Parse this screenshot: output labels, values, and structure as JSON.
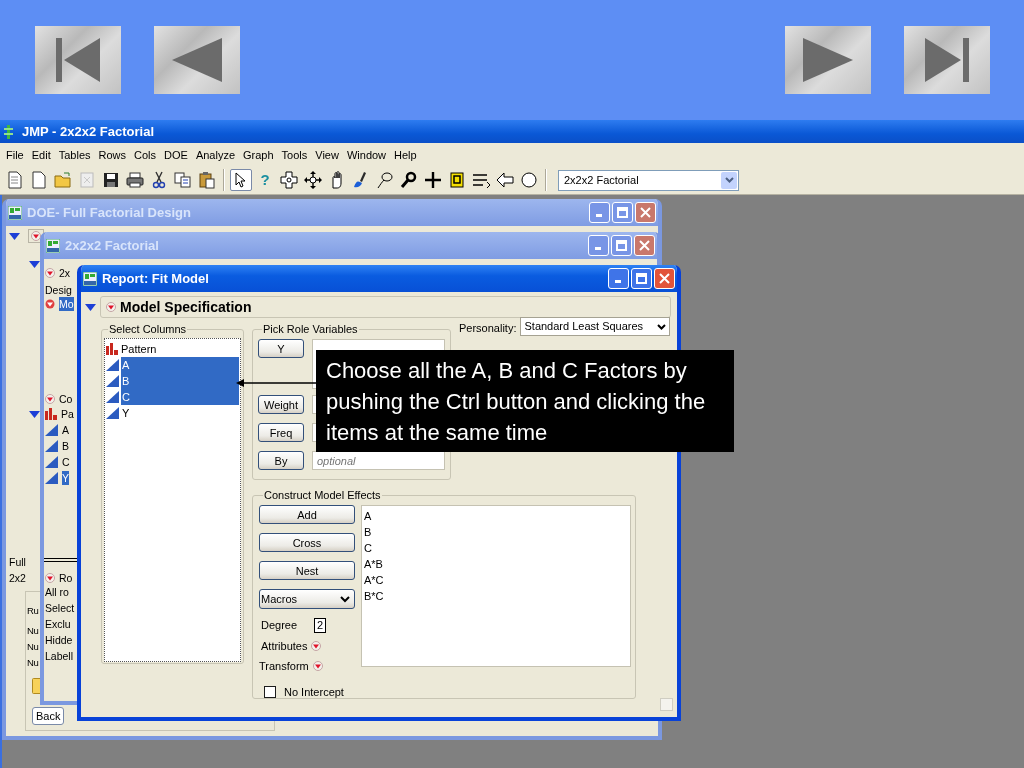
{
  "slide_nav": [
    {
      "kind": "first"
    },
    {
      "kind": "previous"
    },
    {
      "kind": "next"
    },
    {
      "kind": "last"
    }
  ],
  "app": {
    "title": "JMP - 2x2x2 Factorial",
    "menu": [
      "File",
      "Edit",
      "Tables",
      "Rows",
      "Cols",
      "DOE",
      "Analyze",
      "Graph",
      "Tools",
      "View",
      "Window",
      "Help"
    ],
    "tools": [
      {
        "kind": "pointer",
        "selected": true
      },
      {
        "kind": "help",
        "glyph": "?",
        "selected": false
      },
      {
        "kind": "crosshair",
        "selected": false
      },
      {
        "kind": "move",
        "selected": false
      },
      {
        "kind": "hand",
        "selected": false
      },
      {
        "kind": "brush",
        "selected": false
      },
      {
        "kind": "lasso",
        "selected": false
      },
      {
        "kind": "zoom",
        "selected": false
      },
      {
        "kind": "plus",
        "selected": false
      },
      {
        "kind": "annotate",
        "selected": false
      },
      {
        "kind": "lines",
        "selected": false
      },
      {
        "kind": "polygon",
        "selected": false
      },
      {
        "kind": "circle",
        "selected": false
      }
    ],
    "table_select": "2x2x2 Factorial"
  },
  "doe_window": {
    "title": "DOE- Full Factorial Design",
    "lines": [
      "Full",
      "2x2"
    ],
    "panel_lines": [
      "Ru",
      "Nu",
      "Nu",
      "Nu"
    ],
    "back_button": "Back"
  },
  "factorial_window": {
    "title": "2x2x2 Factorial",
    "table_outline": "2x",
    "design_label": "Desig",
    "model_item": "Mo",
    "columns_outline": "Co",
    "columns": [
      {
        "label": "Pa",
        "kind": "nominal",
        "selected": false
      },
      {
        "label": "A",
        "kind": "continuous",
        "selected": false
      },
      {
        "label": "B",
        "kind": "continuous",
        "selected": false
      },
      {
        "label": "C",
        "kind": "continuous",
        "selected": false
      },
      {
        "label": "Y",
        "kind": "continuous",
        "selected": true
      }
    ],
    "rows_outline": "Ro",
    "rows": [
      "All ro",
      "Select",
      "Exclu",
      "Hidde",
      "Labell"
    ]
  },
  "report_window": {
    "title": "Report: Fit Model",
    "outline": "Model Specification",
    "select_columns": {
      "title": "Select Columns",
      "items": [
        {
          "label": "Pattern",
          "kind": "nominal",
          "selected": false
        },
        {
          "label": "A",
          "kind": "continuous",
          "selected": true
        },
        {
          "label": "B",
          "kind": "continuous",
          "selected": true
        },
        {
          "label": "C",
          "kind": "continuous",
          "selected": true
        },
        {
          "label": "Y",
          "kind": "continuous",
          "selected": false
        }
      ]
    },
    "pick_roles": {
      "title": "Pick Role Variables",
      "roles": [
        {
          "label": "Y",
          "kind": "tall"
        },
        {
          "label": "Weight",
          "kind": "single"
        },
        {
          "label": "Freq",
          "kind": "single"
        },
        {
          "label": "By",
          "kind": "single",
          "placeholder": "optional"
        }
      ]
    },
    "personality": {
      "label": "Personality:",
      "value": "Standard Least Squares"
    },
    "construct": {
      "title": "Construct Model Effects",
      "buttons": [
        "Add",
        "Cross",
        "Nest"
      ],
      "macros": "Macros",
      "degree_label": "Degree",
      "degree": "2",
      "attributes": "Attributes",
      "transform": "Transform",
      "no_intercept": {
        "label": "No Intercept",
        "checked": false
      },
      "effects": [
        "A",
        "B",
        "C",
        "A*B",
        "A*C",
        "B*C"
      ]
    }
  },
  "callout": "Choose all the A, B and C Factors by pushing the Ctrl button and clicking the items at the same time"
}
